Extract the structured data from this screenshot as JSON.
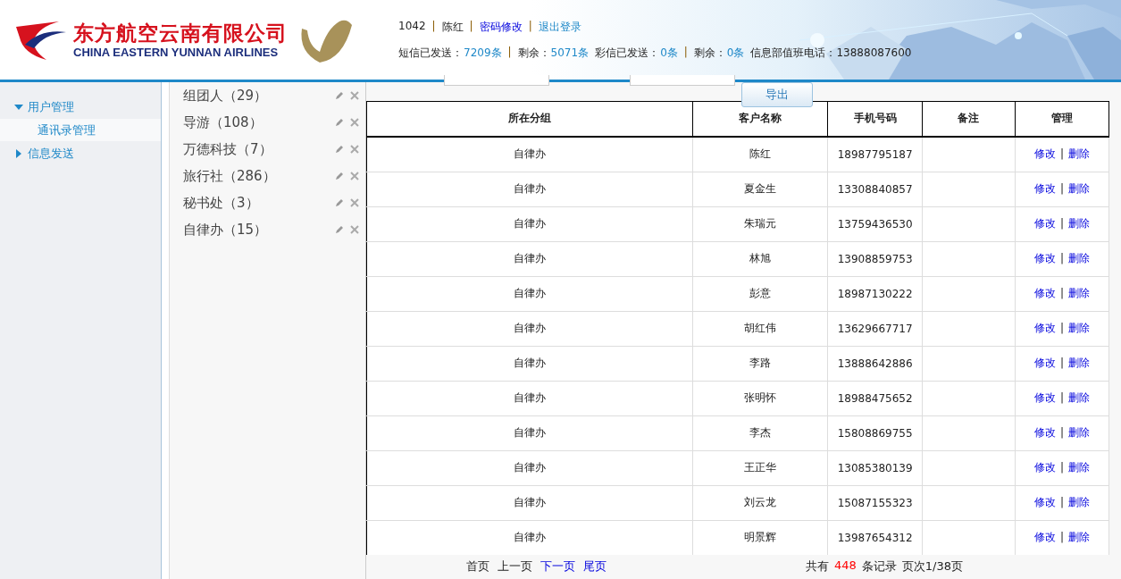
{
  "header": {
    "logo_cn": "东方航空云南有限公司",
    "logo_en": "CHINA EASTERN YUNNAN AIRLINES",
    "user_line": [
      {
        "kind": "text",
        "text": "1042"
      },
      {
        "kind": "sep",
        "text": "|"
      },
      {
        "kind": "text",
        "text": "陈红"
      },
      {
        "kind": "sep",
        "text": "|"
      },
      {
        "kind": "link",
        "text": "密码修改"
      },
      {
        "kind": "sep",
        "text": "|"
      },
      {
        "kind": "link2",
        "text": "退出登录"
      }
    ],
    "stats_line": [
      {
        "kind": "text",
        "text": "短信已发送："
      },
      {
        "kind": "value",
        "text": "7209条"
      },
      {
        "kind": "sep",
        "text": "|"
      },
      {
        "kind": "text",
        "text": "剩余："
      },
      {
        "kind": "value",
        "text": "5071条"
      },
      {
        "kind": "text",
        "text": "彩信已发送："
      },
      {
        "kind": "value",
        "text": "0条"
      },
      {
        "kind": "sep",
        "text": "|"
      },
      {
        "kind": "text",
        "text": "剩余："
      },
      {
        "kind": "value",
        "text": "0条"
      },
      {
        "kind": "text",
        "text": "信息部值班电话：13888087600"
      }
    ]
  },
  "sidebar": {
    "items": [
      {
        "label": "用户管理",
        "expanded": true,
        "children": [
          {
            "label": "通讯录管理",
            "selected": true
          }
        ]
      },
      {
        "label": "信息发送",
        "expanded": false
      }
    ]
  },
  "groups": [
    {
      "label": "组团人（29）"
    },
    {
      "label": "导游（108）"
    },
    {
      "label": "万德科技（7）"
    },
    {
      "label": "旅行社（286）"
    },
    {
      "label": "秘书处（3）"
    },
    {
      "label": "自律办（15）"
    }
  ],
  "export_button": "导出",
  "table": {
    "columns": [
      "所在分组",
      "客户名称",
      "手机号码",
      "备注",
      "管理"
    ],
    "rows": [
      {
        "cells": [
          "自律办",
          "陈红",
          "18987795187",
          ""
        ],
        "actions": [
          "修改",
          "|",
          "删除"
        ]
      },
      {
        "cells": [
          "自律办",
          "夏金生",
          "13308840857",
          ""
        ],
        "actions": [
          "修改",
          "|",
          "删除"
        ]
      },
      {
        "cells": [
          "自律办",
          "朱瑞元",
          "13759436530",
          ""
        ],
        "actions": [
          "修改",
          "|",
          "删除"
        ]
      },
      {
        "cells": [
          "自律办",
          "林旭",
          "13908859753",
          ""
        ],
        "actions": [
          "修改",
          "|",
          "删除"
        ]
      },
      {
        "cells": [
          "自律办",
          "彭意",
          "18987130222",
          ""
        ],
        "actions": [
          "修改",
          "|",
          "删除"
        ]
      },
      {
        "cells": [
          "自律办",
          "胡红伟",
          "13629667717",
          ""
        ],
        "actions": [
          "修改",
          "|",
          "删除"
        ]
      },
      {
        "cells": [
          "自律办",
          "李路",
          "13888642886",
          ""
        ],
        "actions": [
          "修改",
          "|",
          "删除"
        ]
      },
      {
        "cells": [
          "自律办",
          "张明怀",
          "18988475652",
          ""
        ],
        "actions": [
          "修改",
          "|",
          "删除"
        ]
      },
      {
        "cells": [
          "自律办",
          "李杰",
          "15808869755",
          ""
        ],
        "actions": [
          "修改",
          "|",
          "删除"
        ]
      },
      {
        "cells": [
          "自律办",
          "王正华",
          "13085380139",
          ""
        ],
        "actions": [
          "修改",
          "|",
          "删除"
        ]
      },
      {
        "cells": [
          "自律办",
          "刘云龙",
          "15087155323",
          ""
        ],
        "actions": [
          "修改",
          "|",
          "删除"
        ]
      },
      {
        "cells": [
          "自律办",
          "明景辉",
          "13987654312",
          ""
        ],
        "actions": [
          "修改",
          "|",
          "删除"
        ]
      }
    ]
  },
  "pager": {
    "links": [
      {
        "label": "首页",
        "disabled": true
      },
      {
        "label": "上一页",
        "disabled": true
      },
      {
        "label": "下一页",
        "disabled": false
      },
      {
        "label": "尾页",
        "disabled": false
      }
    ],
    "total_prefix": "共有",
    "total": "448",
    "total_suffix": "条记录",
    "page": "页次1/38页"
  }
}
